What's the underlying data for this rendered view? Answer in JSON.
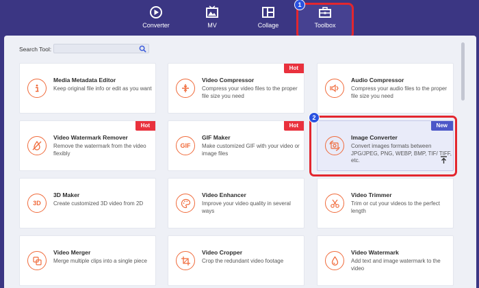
{
  "nav": {
    "items": [
      {
        "label": "Converter",
        "icon": "converter-icon"
      },
      {
        "label": "MV",
        "icon": "mv-icon"
      },
      {
        "label": "Collage",
        "icon": "collage-icon"
      },
      {
        "label": "Toolbox",
        "icon": "toolbox-icon"
      }
    ]
  },
  "steps": [
    "1",
    "2"
  ],
  "search": {
    "label": "Search Tool:",
    "placeholder": ""
  },
  "tools": [
    {
      "title": "Media Metadata Editor",
      "desc": "Keep original file info or edit as you want",
      "icon": "info-icon",
      "badge": ""
    },
    {
      "title": "Video Compressor",
      "desc": "Compress your video files to the proper file size you need",
      "icon": "compress-icon",
      "badge": "Hot"
    },
    {
      "title": "Audio Compressor",
      "desc": "Compress your audio files to the proper file size you need",
      "icon": "audio-compress-icon",
      "badge": ""
    },
    {
      "title": "Video Watermark Remover",
      "desc": "Remove the watermark from the video flexibly",
      "icon": "watermark-remove-icon",
      "badge": "Hot"
    },
    {
      "title": "GIF Maker",
      "desc": "Make customized GIF with your video or image files",
      "icon": "gif-icon",
      "icon_text": "GIF",
      "badge": "Hot"
    },
    {
      "title": "Image Converter",
      "desc": "Convert images formats between JPG/JPEG, PNG, WEBP, BMP, TIF/ TIFF, etc.",
      "icon": "image-converter-icon",
      "badge": "New"
    },
    {
      "title": "3D Maker",
      "desc": "Create customized 3D video from 2D",
      "icon": "3d-icon",
      "icon_text": "3D",
      "badge": ""
    },
    {
      "title": "Video Enhancer",
      "desc": "Improve your video quality in several ways",
      "icon": "palette-icon",
      "badge": ""
    },
    {
      "title": "Video Trimmer",
      "desc": "Trim or cut your videos to the perfect length",
      "icon": "scissors-icon",
      "badge": ""
    },
    {
      "title": "Video Merger",
      "desc": "Merge multiple clips into a single piece",
      "icon": "merge-icon",
      "badge": ""
    },
    {
      "title": "Video Cropper",
      "desc": "Crop the redundant video footage",
      "icon": "crop-icon",
      "badge": ""
    },
    {
      "title": "Video Watermark",
      "desc": "Add text and image watermark to the video",
      "icon": "drop-icon",
      "badge": ""
    }
  ],
  "colors": {
    "header_bg": "#3b3683",
    "accent": "#f06a3a",
    "hot": "#e9313d",
    "new": "#4c57c8",
    "highlight": "#e3262e"
  }
}
